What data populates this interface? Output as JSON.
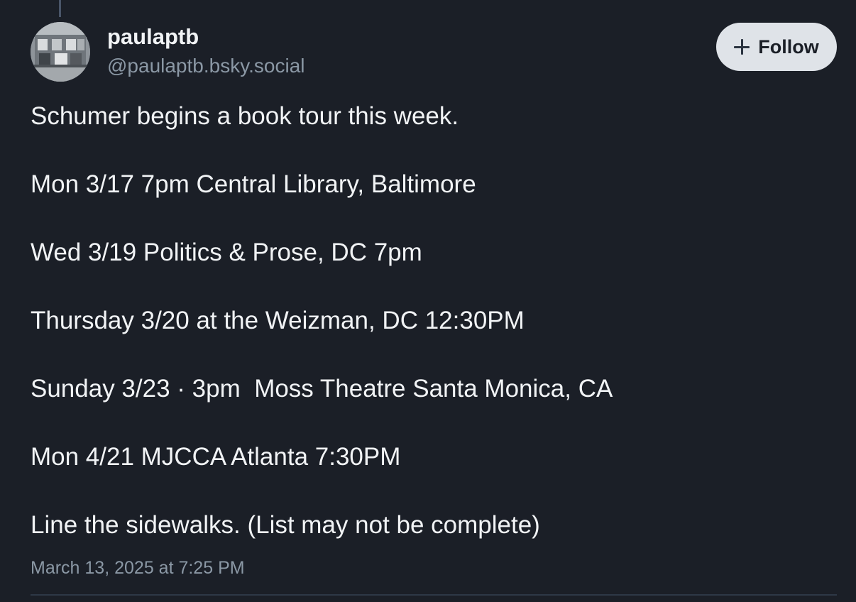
{
  "author": {
    "display_name": "paulaptb",
    "handle": "@paulaptb.bsky.social",
    "avatar_icon": "building-photo-avatar"
  },
  "follow_button": {
    "icon": "plus-icon",
    "label": "Follow"
  },
  "post": {
    "lines": [
      "Schumer begins a book tour this week.",
      "Mon 3/17 7pm Central Library, Baltimore",
      "Wed 3/19 Politics & Prose, DC 7pm",
      "Thursday 3/20 at the Weizman, DC 12:30PM",
      "Sunday 3/23 · 3pm  Moss Theatre Santa Monica, CA",
      "Mon 4/21 MJCCA Atlanta 7:30PM",
      "Line the sidewalks. (List may not be complete)"
    ],
    "timestamp": "March 13, 2025 at 7:25 PM"
  },
  "colors": {
    "background": "#1b1f27",
    "text": "#f1f3f5",
    "muted": "#8b98a5",
    "follow_bg": "#dfe3e8"
  }
}
